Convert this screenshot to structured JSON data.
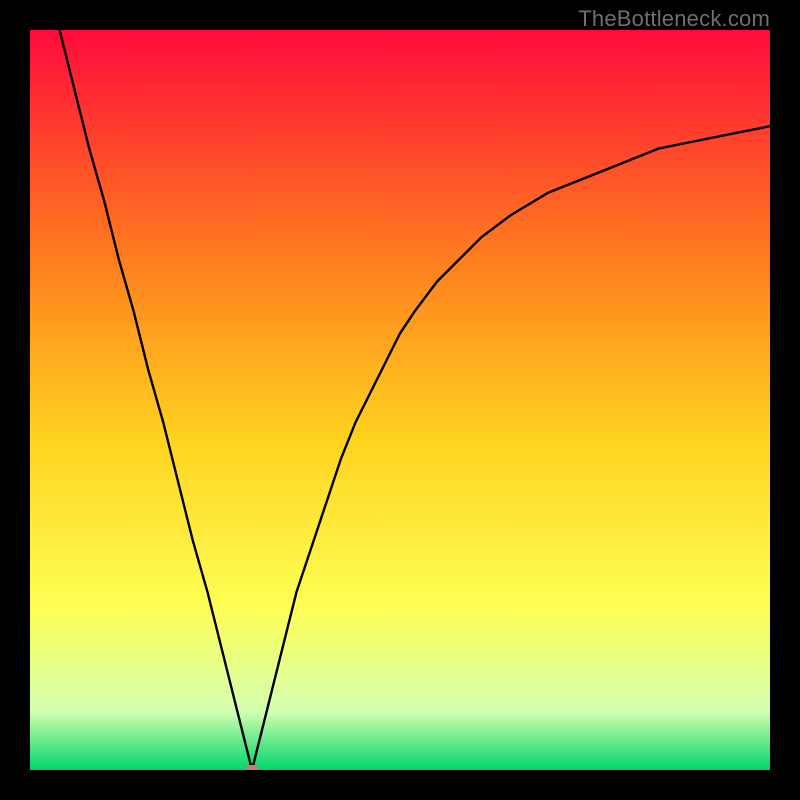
{
  "watermark": "TheBottleneck.com",
  "colors": {
    "frame": "#000000",
    "gradient_top": "#ff0b3a",
    "gradient_mid1": "#ff7a1f",
    "gradient_mid2": "#ffd21f",
    "gradient_mid3": "#ffff55",
    "gradient_low": "#d4ffb0",
    "gradient_bottom": "#00d66b",
    "curve": "#000000",
    "marker": "#c97b75"
  },
  "chart_data": {
    "type": "line",
    "title": "",
    "xlabel": "",
    "ylabel": "",
    "xlim": [
      0,
      100
    ],
    "ylim": [
      0,
      100
    ],
    "minimum_x": 30,
    "curve_points": [
      [
        4,
        100
      ],
      [
        6,
        92
      ],
      [
        8,
        84
      ],
      [
        10,
        77
      ],
      [
        12,
        69
      ],
      [
        14,
        62
      ],
      [
        16,
        54
      ],
      [
        18,
        47
      ],
      [
        20,
        39
      ],
      [
        22,
        31
      ],
      [
        24,
        24
      ],
      [
        26,
        16
      ],
      [
        28,
        8
      ],
      [
        30,
        0
      ],
      [
        32,
        8
      ],
      [
        34,
        16
      ],
      [
        36,
        24
      ],
      [
        38,
        30
      ],
      [
        40,
        36
      ],
      [
        42,
        42
      ],
      [
        44,
        47
      ],
      [
        46,
        51
      ],
      [
        48,
        55
      ],
      [
        50,
        59
      ],
      [
        52,
        62
      ],
      [
        55,
        66
      ],
      [
        58,
        69
      ],
      [
        61,
        72
      ],
      [
        65,
        75
      ],
      [
        70,
        78
      ],
      [
        75,
        80
      ],
      [
        80,
        82
      ],
      [
        85,
        84
      ],
      [
        90,
        85
      ],
      [
        95,
        86
      ],
      [
        100,
        87
      ]
    ],
    "marker": {
      "x": 30,
      "y": 0
    }
  }
}
